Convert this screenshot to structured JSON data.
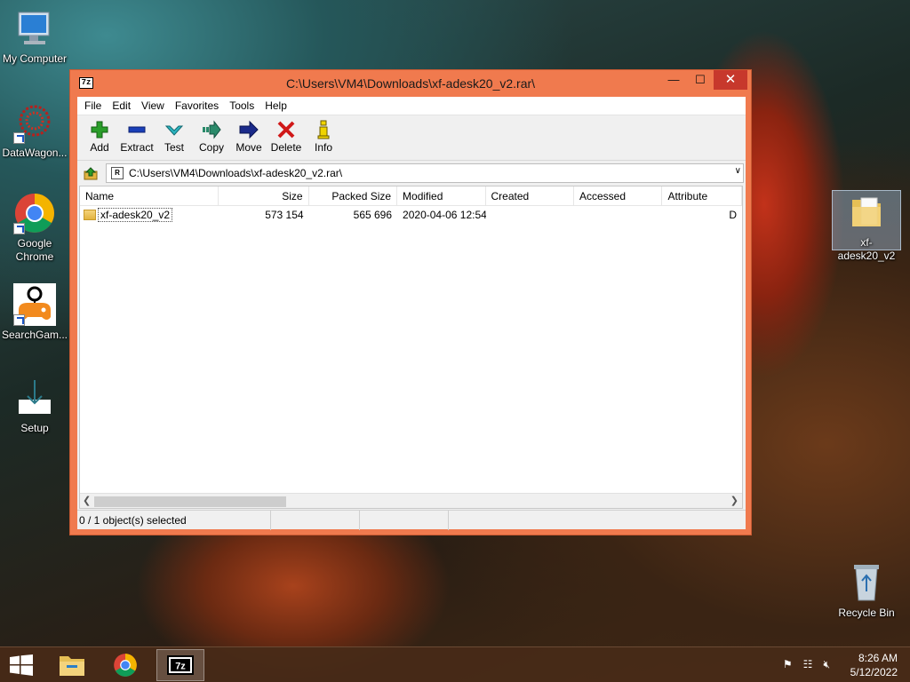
{
  "desktop": {
    "icons": [
      {
        "label": "My Computer"
      },
      {
        "label": "DataWagon..."
      },
      {
        "label": "Google Chrome"
      },
      {
        "label": "SearchGam..."
      },
      {
        "label": "Setup"
      },
      {
        "label": "xf-adesk20_v2"
      },
      {
        "label": "Recycle Bin"
      }
    ]
  },
  "window": {
    "title": "C:\\Users\\VM4\\Downloads\\xf-adesk20_v2.rar\\",
    "app_icon": "7z",
    "controls": {
      "minimize": "—",
      "maximize": "☐",
      "close": "✕"
    },
    "menu": [
      "File",
      "Edit",
      "View",
      "Favorites",
      "Tools",
      "Help"
    ],
    "toolbar": [
      {
        "label": "Add",
        "icon": "plus-icon",
        "color": "#2a9d2a"
      },
      {
        "label": "Extract",
        "icon": "minus-icon",
        "color": "#1a3fb8"
      },
      {
        "label": "Test",
        "icon": "check-icon",
        "color": "#2bb5c0"
      },
      {
        "label": "Copy",
        "icon": "copy-arrow-icon",
        "color": "#2a8a6a"
      },
      {
        "label": "Move",
        "icon": "move-arrow-icon",
        "color": "#1a2a8a"
      },
      {
        "label": "Delete",
        "icon": "delete-x-icon",
        "color": "#d01818"
      },
      {
        "label": "Info",
        "icon": "info-icon",
        "color": "#c8a800"
      }
    ],
    "address": "C:\\Users\\VM4\\Downloads\\xf-adesk20_v2.rar\\",
    "columns": [
      "Name",
      "Size",
      "Packed Size",
      "Modified",
      "Created",
      "Accessed",
      "Attribute"
    ],
    "rows": [
      {
        "name": "xf-adesk20_v2",
        "size": "573 154",
        "packed": "565 696",
        "modified": "2020-04-06 12:54",
        "created": "",
        "accessed": "",
        "attr": "D"
      }
    ],
    "status": "0 / 1 object(s) selected"
  },
  "taskbar": {
    "apps": [
      "file-explorer",
      "google-chrome",
      "7-zip"
    ],
    "tray_icons": [
      "action-center-flag-icon",
      "network-icon",
      "volume-muted-icon"
    ],
    "time": "8:26 AM",
    "date": "5/12/2022"
  },
  "colors": {
    "window_frame": "#f07a4e",
    "close_button": "#c7382c",
    "taskbar": "#482a18"
  }
}
